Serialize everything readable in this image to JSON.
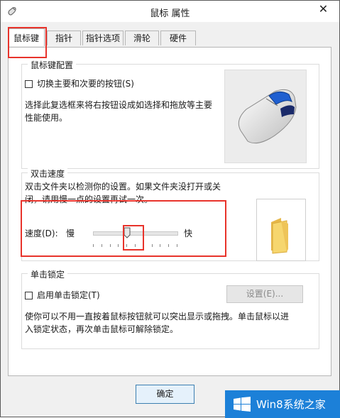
{
  "window": {
    "title": "鼠标 属性",
    "close_glyph": "✕"
  },
  "tabs": [
    {
      "label": "鼠标键",
      "active": true
    },
    {
      "label": "指针"
    },
    {
      "label": "指针选项"
    },
    {
      "label": "滑轮"
    },
    {
      "label": "硬件"
    }
  ],
  "button_config": {
    "title": "鼠标键配置",
    "checkbox_label": "切换主要和次要的按钮(S)",
    "description_line1": "选择此复选框来将右按钮设成如选择和拖放等主要",
    "description_line2": "性能使用。"
  },
  "double_click": {
    "title": "双击速度",
    "description_line1": "双击文件夹以检测你的设置。如果文件夹没打开或关",
    "description_line2": "闭，请用慢一点的设置再试一次。",
    "speed_label": "速度(D):",
    "slow_label": "慢",
    "fast_label": "快",
    "speed_value_fraction": 0.41
  },
  "click_lock": {
    "title": "单击锁定",
    "checkbox_label": "启用单击锁定(T)",
    "settings_button": "设置(E)...",
    "description_line1": "使你可以不用一直按着鼠标按钮就可以突出显示或拖拽。单击鼠标以进",
    "description_line2": "入锁定状态，再次单击鼠标可解除锁定。"
  },
  "footer": {
    "ok_button": "确定"
  },
  "watermark": {
    "text": "Win8系统之家"
  },
  "colors": {
    "highlight_red": "#e8332b",
    "watermark_blue": "#1c80d8"
  }
}
